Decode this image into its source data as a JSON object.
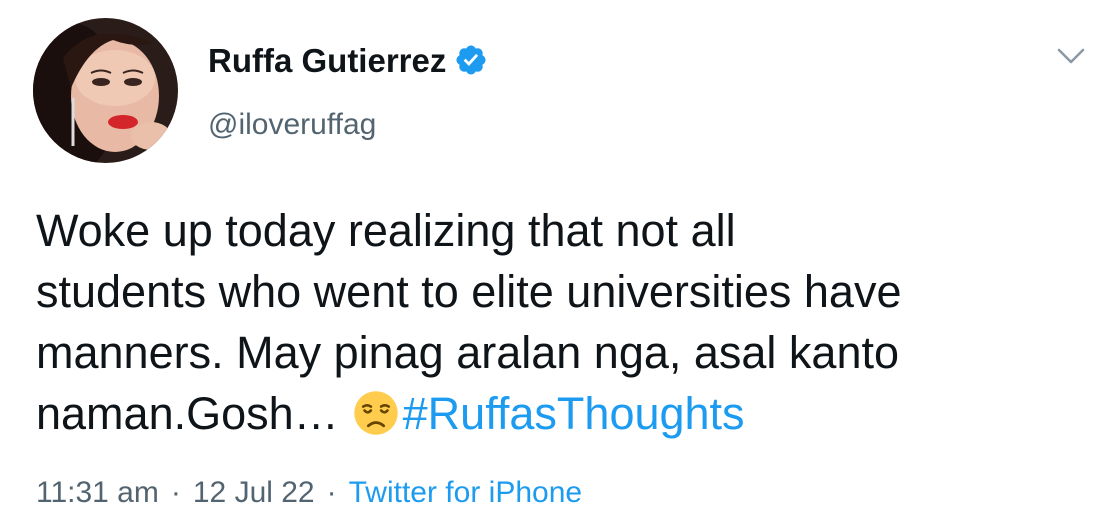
{
  "author": {
    "display_name": "Ruffa Gutierrez",
    "handle": "@iloveruffag",
    "verified": true
  },
  "tweet": {
    "lines": [
      "Woke up today realizing that not all",
      "students who went to elite universities have",
      "manners. May pinag aralan nga, asal kanto",
      "naman.Gosh…"
    ],
    "emoji": "disappointed-face-emoji",
    "hashtag": "#RuffasThoughts"
  },
  "meta": {
    "time": "11:31 am",
    "separator": "·",
    "date": "12 Jul 22",
    "source": "Twitter for iPhone"
  },
  "colors": {
    "accent": "#1d9bf0",
    "text": "#0f1419",
    "secondary": "#536471"
  }
}
